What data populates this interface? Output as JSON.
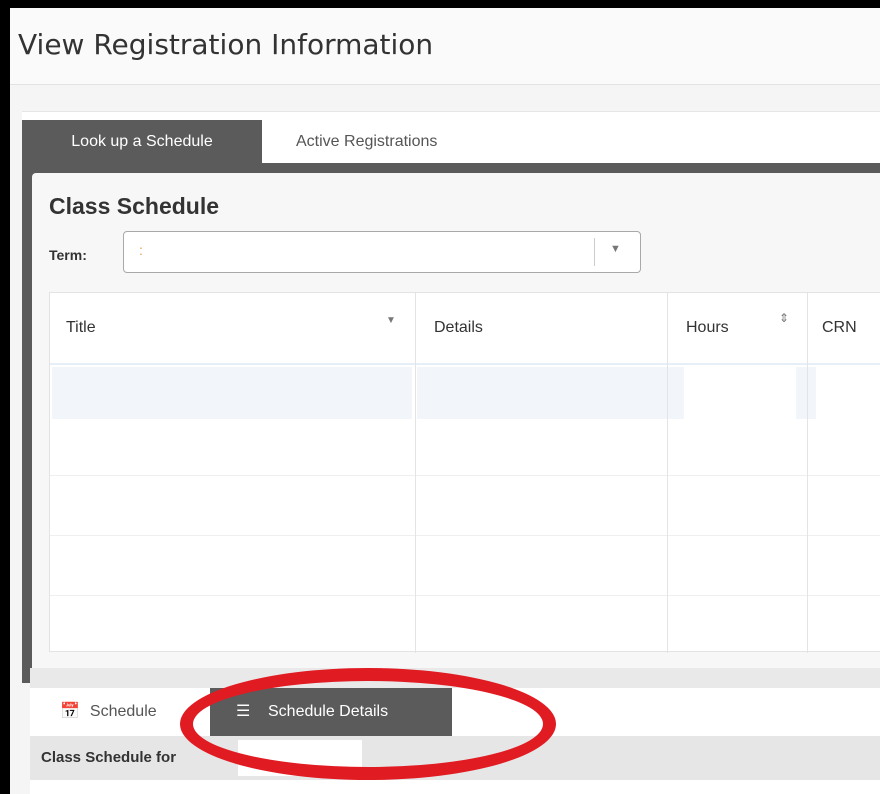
{
  "page": {
    "title": "View Registration Information"
  },
  "tabs": [
    {
      "label": "Look up a Schedule",
      "active": true
    },
    {
      "label": "Active Registrations",
      "active": false
    }
  ],
  "schedule": {
    "heading": "Class Schedule",
    "term_label": "Term:",
    "term_value": ":"
  },
  "grid": {
    "columns": [
      "Title",
      "Details",
      "Hours",
      "CRN"
    ]
  },
  "bottom_tabs": [
    {
      "label": "Schedule",
      "icon": "calendar-icon",
      "active": false
    },
    {
      "label": "Schedule Details",
      "icon": "list-icon",
      "active": true
    }
  ],
  "schedule_for": {
    "label": "Class Schedule for"
  },
  "colors": {
    "tab_active_bg": "#5b5b5b",
    "annotation_ring": "#e11b22",
    "term_value": "#e0a050"
  }
}
